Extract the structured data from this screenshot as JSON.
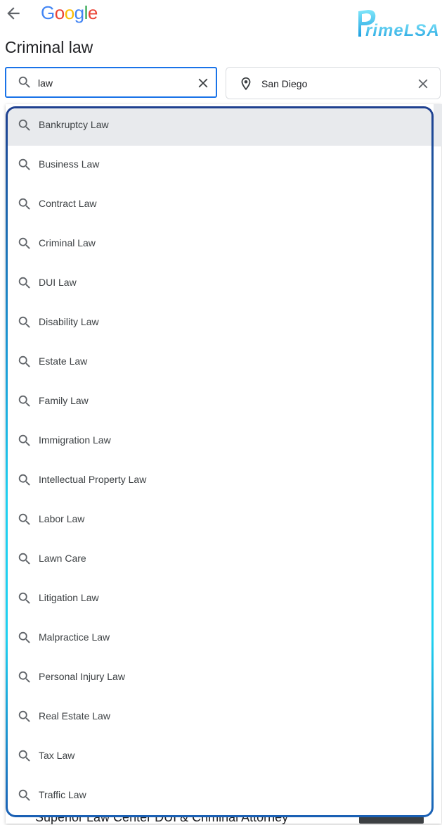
{
  "header": {
    "logo_letters": [
      "G",
      "o",
      "o",
      "g",
      "l",
      "e"
    ],
    "logo_colors": [
      "#4285F4",
      "#EA4335",
      "#FBBC05",
      "#4285F4",
      "#34A853",
      "#EA4335"
    ],
    "brand_text": "rimeLSA"
  },
  "page_title": "Criminal law",
  "search": {
    "value": "law"
  },
  "location": {
    "value": "San Diego"
  },
  "suggestions": [
    {
      "label": "Bankruptcy Law",
      "active": true
    },
    {
      "label": "Business Law"
    },
    {
      "label": "Contract Law"
    },
    {
      "label": "Criminal Law"
    },
    {
      "label": "DUI Law"
    },
    {
      "label": "Disability Law"
    },
    {
      "label": "Estate Law"
    },
    {
      "label": "Family Law"
    },
    {
      "label": "Immigration Law"
    },
    {
      "label": "Intellectual Property Law"
    },
    {
      "label": "Labor Law"
    },
    {
      "label": "Lawn Care"
    },
    {
      "label": "Litigation Law"
    },
    {
      "label": "Malpractice Law"
    },
    {
      "label": "Personal Injury Law"
    },
    {
      "label": "Real Estate Law"
    },
    {
      "label": "Tax Law"
    },
    {
      "label": "Traffic Law"
    }
  ],
  "behind": {
    "partial_text": "Superior Law Center DUI & Criminal Attorney"
  }
}
